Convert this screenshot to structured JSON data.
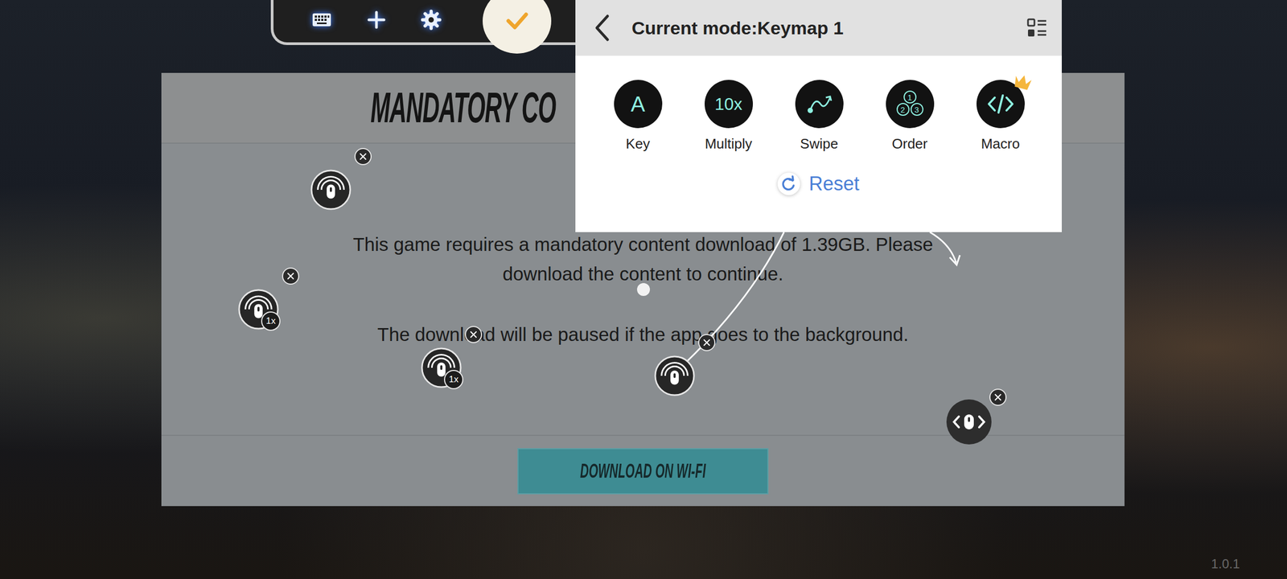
{
  "dialog": {
    "title": "MANDATORY CO",
    "paragraphs": [
      [
        "This game requires a mandatory content download of 1.39GB. Please",
        "download the content to continue."
      ],
      [
        "The download will be paused if the app goes to the background."
      ]
    ],
    "button": "DOWNLOAD ON WI-FI"
  },
  "version": "1.0.1",
  "keymap_panel": {
    "title": "Current mode:Keymap 1",
    "tools": [
      {
        "label": "Key",
        "kind": "key",
        "glyph": "A",
        "premium": false
      },
      {
        "label": "Multiply",
        "kind": "multiply",
        "glyph": "10x",
        "premium": false
      },
      {
        "label": "Swipe",
        "kind": "swipe",
        "premium": false
      },
      {
        "label": "Order",
        "kind": "order",
        "glyph": [
          "1",
          "2",
          "3"
        ],
        "premium": false
      },
      {
        "label": "Macro",
        "kind": "macro",
        "premium": true
      }
    ],
    "reset": "Reset"
  },
  "markers": [
    {
      "kind": "tap",
      "badge": "",
      "closable": true
    },
    {
      "kind": "tap",
      "badge": "1x",
      "closable": true
    },
    {
      "kind": "tap",
      "badge": "1x",
      "closable": true
    },
    {
      "kind": "swipe",
      "badge": "",
      "closable": true
    },
    {
      "kind": "scroll",
      "badge": "",
      "closable": true
    },
    {
      "kind": "point",
      "badge": "",
      "closable": false
    }
  ]
}
